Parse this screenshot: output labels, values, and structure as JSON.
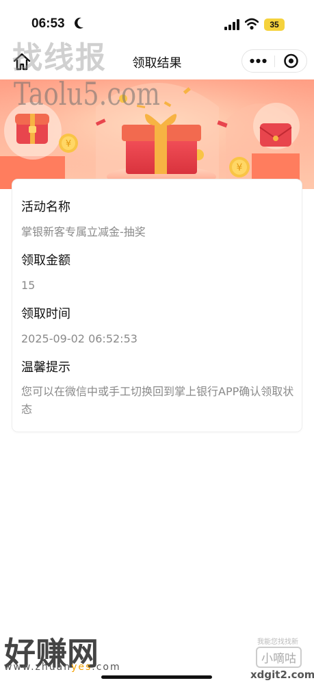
{
  "status_bar": {
    "time": "06:53",
    "battery": "35"
  },
  "nav": {
    "title": "领取结果"
  },
  "watermarks": {
    "top": "找线报",
    "taolu": "Taolu5.com",
    "bottom": "好赚网",
    "url_prefix": "www.zhuan",
    "url_highlight": "yes",
    "url_suffix": ".com",
    "br_small": "我能您找找新",
    "br_box": "小嘀咕",
    "br_url": "xdgit2.com"
  },
  "result": {
    "fields": [
      {
        "label": "活动名称",
        "value": "掌银新客专属立减金-抽奖"
      },
      {
        "label": "领取金额",
        "value": "15"
      },
      {
        "label": "领取时间",
        "value": "2025-09-02 06:52:53"
      },
      {
        "label": "温馨提示",
        "value": "您可以在微信中或手工切换回到掌上银行APP确认领取状态"
      }
    ]
  },
  "colors": {
    "banner_top": "#ff9e84",
    "gift_box": "#e8454d",
    "ribbon": "#f7b343"
  }
}
